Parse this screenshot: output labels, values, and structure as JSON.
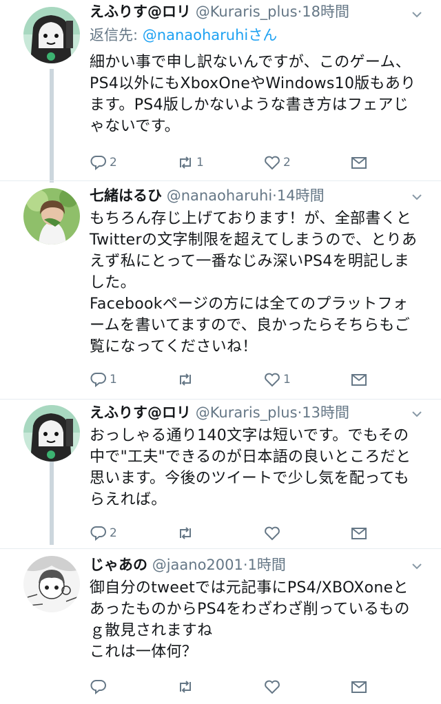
{
  "tweets": [
    {
      "name": "えふりす@ロリ",
      "handle": "@Kuraris_plus",
      "time": "·18時間",
      "reply_to_prefix": "返信先: ",
      "reply_to_mention": "@nanaoharuhiさん",
      "body": "細かい事で申し訳ないんですが、このゲーム、PS4以外にもXboxOneやWindows10版もあります。PS4版しかないような書き方はフェアじゃないです。",
      "replies": "2",
      "retweets": "1",
      "likes": "2"
    },
    {
      "name": "七緒はるひ",
      "handle": "@nanaoharuhi",
      "time": "·14時間",
      "body": "もちろん存じ上げております！が、全部書くとTwitterの文字制限を超えてしまうので、とりあえず私にとって一番なじみ深いPS4を明記しました。\nFacebookページの方には全てのプラットフォームを書いてますので、良かったらそちらもご覧になってくださいね！",
      "replies": "1",
      "retweets": "",
      "likes": "1"
    },
    {
      "name": "えふりす@ロリ",
      "handle": "@Kuraris_plus",
      "time": "·13時間",
      "body": "おっしゃる通り140文字は短いです。でもその中で\"工夫\"できるのが日本語の良いところだと思います。今後のツイートで少し気を配ってもらえれば。",
      "replies": "2",
      "retweets": "",
      "likes": ""
    },
    {
      "name": "じゃあの",
      "handle": "@jaano2001",
      "time": "·1時間",
      "body": "御自分のtweetでは元記事にPS4/XBOXoneとあったものからPS4をわざわざ削っているものｇ散見されますね\nこれは一体何？",
      "replies": "",
      "retweets": "",
      "likes": ""
    }
  ],
  "colors": {
    "accent": "#1da1f2",
    "muted": "#657786",
    "thread_line": "#ccd6dd"
  },
  "icons": [
    "reply-icon",
    "retweet-icon",
    "like-icon",
    "share-icon",
    "chevron-down-icon"
  ]
}
